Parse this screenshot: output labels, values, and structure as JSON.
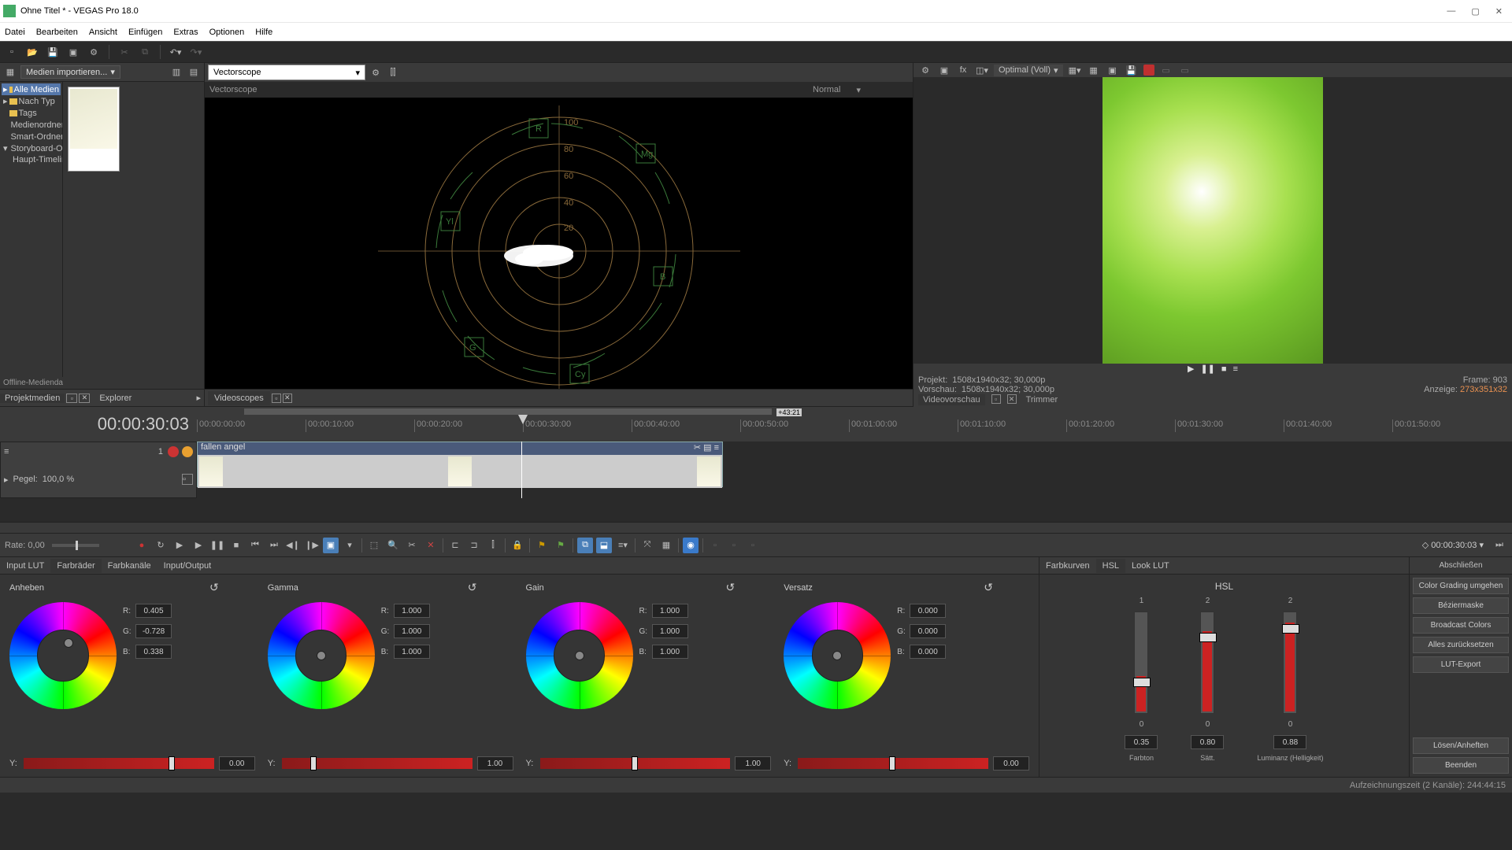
{
  "title": "Ohne Titel * - VEGAS Pro 18.0",
  "menu": [
    "Datei",
    "Bearbeiten",
    "Ansicht",
    "Einfügen",
    "Extras",
    "Optionen",
    "Hilfe"
  ],
  "media": {
    "import_label": "Medien importieren...",
    "tree": [
      "Alle Medien",
      "Nach Typ",
      "Tags",
      "Medienordner",
      "Smart-Ordner",
      "Storyboard-Ordner",
      "Haupt-Timeline"
    ],
    "offline": "Offline-Medienda",
    "tabs": {
      "project": "Projektmedien",
      "explorer": "Explorer"
    }
  },
  "scopes": {
    "select": "Vectorscope",
    "header": "Vectorscope",
    "mode": "Normal",
    "tab": "Videoscopes"
  },
  "preview": {
    "quality": "Optimal (Voll)",
    "info": {
      "projekt_label": "Projekt:",
      "projekt": "1508x1940x32; 30,000p",
      "vorschau_label": "Vorschau:",
      "vorschau": "1508x1940x32; 30,000p",
      "frame_label": "Frame:",
      "frame": "903",
      "anzeige_label": "Anzeige:",
      "anzeige": "273x351x32",
      "tab1": "Videovorschau",
      "tab2": "Trimmer"
    }
  },
  "timeline": {
    "current": "00:00:30:03",
    "zoom_mark": "+43:21",
    "ticks": [
      "00:00:00:00",
      "00:00:10:00",
      "00:00:20:00",
      "00:00:30:00",
      "00:00:40:00",
      "00:00:50:00",
      "00:01:00:00",
      "00:01:10:00",
      "00:01:20:00",
      "00:01:30:00",
      "00:01:40:00",
      "00:01:50:00"
    ],
    "clip_name": "fallen angel",
    "track_num": "1",
    "pegel_label": "Pegel:",
    "pegel_value": "100,0 %",
    "rate": "Rate: 0,00",
    "time_right": "00:00:30:03"
  },
  "grading": {
    "left_tabs": [
      "Input LUT",
      "Farbräder",
      "Farbkanäle",
      "Input/Output"
    ],
    "right_tabs": [
      "Farbkurven",
      "HSL",
      "Look LUT"
    ],
    "wheels": [
      {
        "name": "Anheben",
        "r": "0.405",
        "g": "-0.728",
        "b": "0.338",
        "y": "0.00",
        "hx": 55,
        "hy": 38,
        "th": 76
      },
      {
        "name": "Gamma",
        "r": "1.000",
        "g": "1.000",
        "b": "1.000",
        "y": "1.00",
        "hx": 50,
        "hy": 50,
        "th": 15
      },
      {
        "name": "Gain",
        "r": "1.000",
        "g": "1.000",
        "b": "1.000",
        "y": "1.00",
        "hx": 50,
        "hy": 50,
        "th": 48
      },
      {
        "name": "Versatz",
        "r": "0.000",
        "g": "0.000",
        "b": "0.000",
        "y": "0.00",
        "hx": 50,
        "hy": 50,
        "th": 48
      }
    ],
    "hsl": {
      "title": "HSL",
      "top": [
        "1",
        "2",
        "2"
      ],
      "bottom": [
        "0",
        "0",
        "0"
      ],
      "values": [
        "0.35",
        "0.80",
        "0.88"
      ],
      "labels": [
        "Farbton",
        "Sätt.",
        "Luminanz\n(Helligkeit)"
      ]
    },
    "close": "Abschließen",
    "buttons": [
      "Color Grading umgehen",
      "Béziermaske",
      "Broadcast Colors",
      "Alles zurücksetzen",
      "LUT-Export",
      "Lösen/Anheften",
      "Beenden"
    ]
  },
  "status": "Aufzeichnungszeit (2 Kanäle): 244:44:15"
}
